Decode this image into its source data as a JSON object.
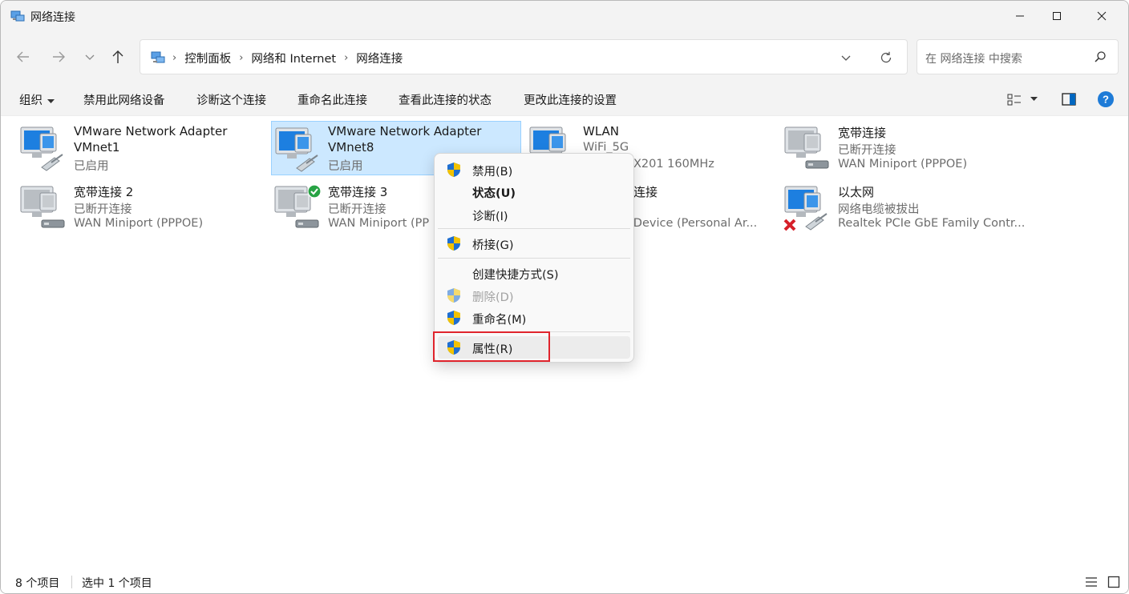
{
  "window": {
    "title": "网络连接"
  },
  "nav": {
    "back": "back",
    "forward": "forward",
    "recent": "recent",
    "up": "up"
  },
  "address": {
    "crumbs": [
      "控制面板",
      "网络和 Internet",
      "网络连接"
    ],
    "search_placeholder": "在 网络连接 中搜索"
  },
  "toolbar": {
    "organize": "组织",
    "disable": "禁用此网络设备",
    "diagnose": "诊断这个连接",
    "rename": "重命名此连接",
    "status": "查看此连接的状态",
    "settings": "更改此连接的设置"
  },
  "items": [
    {
      "name": "VMware Network Adapter",
      "name2": "VMnet1",
      "status": "已启用",
      "detail": "",
      "kind": "lan-cable",
      "selected": false
    },
    {
      "name": "VMware Network Adapter",
      "name2": "VMnet8",
      "status": "已启用",
      "detail": "",
      "kind": "lan-cable",
      "selected": true
    },
    {
      "name": "WLAN",
      "name2": "",
      "status": "WiFi_5G",
      "detail": "Wi-Fi 6 AX201 160MHz",
      "kind": "wlan",
      "selected": false
    },
    {
      "name": "宽带连接",
      "name2": "",
      "status": "已断开连接",
      "detail": "WAN Miniport (PPPOE)",
      "kind": "modem",
      "selected": false
    },
    {
      "name": "宽带连接 2",
      "name2": "",
      "status": "已断开连接",
      "detail": "WAN Miniport (PPPOE)",
      "kind": "modem",
      "selected": false
    },
    {
      "name": "宽带连接 3",
      "name2": "",
      "status": "已断开连接",
      "detail": "WAN Miniport (PP",
      "kind": "modem-check",
      "selected": false
    },
    {
      "name": "连接",
      "name2": "",
      "status": "",
      "detail": "h Device (Personal Ar...",
      "kind": "bluetooth",
      "selected": false
    },
    {
      "name": "以太网",
      "name2": "",
      "status": "网络电缆被拔出",
      "detail": "Realtek PCIe GbE Family Contr...",
      "kind": "lan-unplugged",
      "selected": false
    }
  ],
  "context_menu": {
    "disable": "禁用(B)",
    "status": "状态(U)",
    "diagnose": "诊断(I)",
    "bridge": "桥接(G)",
    "shortcut": "创建快捷方式(S)",
    "delete": "删除(D)",
    "rename": "重命名(M)",
    "properties": "属性(R)"
  },
  "statusbar": {
    "count": "8 个项目",
    "selected": "选中 1 个项目"
  },
  "colors": {
    "accent": "#0067c0",
    "selection": "#cce8ff",
    "highlight_box": "#e0242c",
    "shield_yellow": "#f2c200",
    "shield_blue": "#1f6fd1"
  }
}
